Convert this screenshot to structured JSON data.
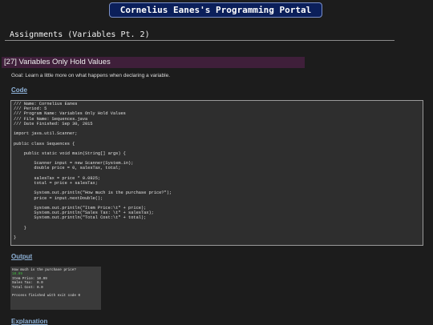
{
  "header": {
    "portal_title": "Cornelius Eanes's Programming Portal"
  },
  "section": {
    "title": "Assignments (Variables Pt. 2)"
  },
  "lesson": {
    "title": "[27] Variables Only Hold Values",
    "goal": "Goal: Learn a little more on what happens when declaring a variable."
  },
  "code_section": {
    "heading": "Code",
    "lines": [
      "/// Name: Cornelius Eanes",
      "/// Period: 5",
      "/// Program Name: Variables Only Hold Values",
      "/// File Name: Sequences.java",
      "/// Date Finished: Sep 30, 2015",
      "",
      "import java.util.Scanner;",
      "",
      "public class Sequences {",
      "",
      "    public static void main(String[] args) {",
      "",
      "        Scanner input = new Scanner(System.in);",
      "        double price = 0, salesTax, total;",
      "",
      "        salesTax = price * 0.0825;",
      "        total = price + salesTax;",
      "",
      "        System.out.println(\"How much is the purchase price?\");",
      "        price = input.nextDouble();",
      "",
      "        System.out.println(\"Item Price:\\t\" + price);",
      "        System.out.println(\"Sales Tax: \\t\" + salesTax);",
      "        System.out.println(\"Total Cost:\\t\" + total);",
      "",
      "    }",
      "",
      "}"
    ]
  },
  "output_section": {
    "heading": "Output",
    "lines": [
      {
        "text": "How much is the purchase price?",
        "color": "#e0e0e0"
      },
      {
        "text": "10.99",
        "color": "#3fbf3f"
      },
      {
        "text": "Item Price: 10.99",
        "color": "#e0e0e0"
      },
      {
        "text": "Sales Tax:  0.0",
        "color": "#e0e0e0"
      },
      {
        "text": "Total Cost: 0.0",
        "color": "#e0e0e0"
      },
      {
        "text": "",
        "color": "#e0e0e0"
      },
      {
        "text": "Process finished with exit code 0",
        "color": "#e0e0e0"
      }
    ]
  },
  "explanation_section": {
    "heading": "Explanation"
  }
}
